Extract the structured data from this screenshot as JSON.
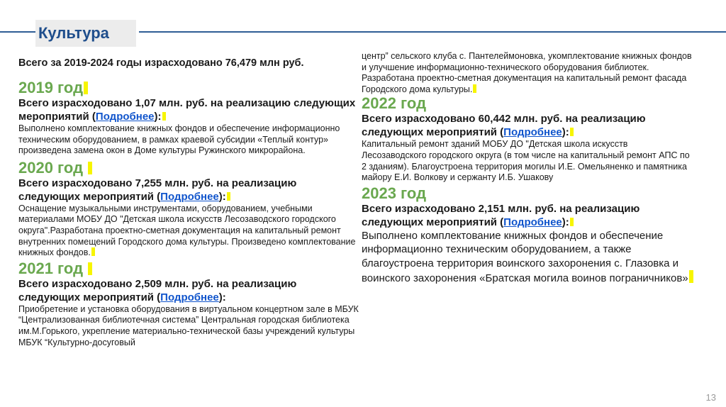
{
  "slide": {
    "title": "Культура",
    "page_number": "13",
    "more_link": "Подробнее",
    "total": "Всего за 2019-2024 годы израсходовано 76,479 млн руб.",
    "accent_colors": {
      "rule": "#2e5d95",
      "year": "#6aa84f",
      "highlight": "#f7f500",
      "link": "#1155cc"
    }
  },
  "years": [
    {
      "year": "2019 год",
      "summary_pre": "Всего израсходовано 1,07 млн. руб.  на реализацию следующих мероприятий (",
      "summary_post": "):",
      "text": "Выполнено комплектование книжных фондов и обеспечение информационно техническим оборудованием, в рамках краевой субсидии «Теплый контур» произведена замена окон в Доме культуры Ружинского микрорайона."
    },
    {
      "year": "2020 год",
      "summary_pre": "Всего израсходовано 7,255 млн. руб.  на реализацию следующих мероприятий (",
      "summary_post": "):",
      "text": " Оснащение музыкальными инструментами, оборудованием, учебными материалами МОБУ ДО \"Детская школа искусств Лесозаводского городского округа\".Разработана проектно-сметная документация на капитальный ремонт внутренних помещений Городского дома культуры. Произведено комплектование книжных фондов."
    },
    {
      "year": "2021 год",
      "summary_pre": "Всего израсходовано 2,509 млн. руб.  на реализацию следующих мероприятий (",
      "summary_post": "):",
      "text": "Приобретение и установка оборудования в виртуальном концертном зале в МБУК “Централизованная библиотечная система” Центральная городская библиотека им.М.Горького, укрепление материально-технической базы учреждений культуры МБУК “Культурно-досуговый",
      "continuation": "центр” сельского клуба с. Пантелеймоновка, укомплектование книжных фондов и улучшение информационно-технического оборудования библиотек. Разработана проектно-сметная документация на капитальный ремонт фасада Городского дома культуры."
    },
    {
      "year": "2022 год",
      "summary_pre": "Всего израсходовано 60,442 млн. руб.  на реализацию следующих мероприятий (",
      "summary_post": "):",
      "text": "Капитальный ремонт зданий МОБУ ДО \"Детская школа искусств Лесозаводского городского округа  (в том числе на капитальный ремонт АПС по 2 зданиям). Благоустроена территория могилы И.Е. Омельяненко и памятника майору Е.И. Волкову и сержанту И.Б. Ушакову"
    },
    {
      "year": "2023 год",
      "summary_pre": "Всего израсходовано 2,151 млн. руб.  на реализацию следующих мероприятий (",
      "summary_post": "):",
      "text": "Выполнено комплектование книжных фондов и обеспечение информационно техническим оборудованием, а также благоустроена территория воинского захоронения с. Глазовка и воинского захоронения «Братская могила воинов пограничников»"
    }
  ]
}
